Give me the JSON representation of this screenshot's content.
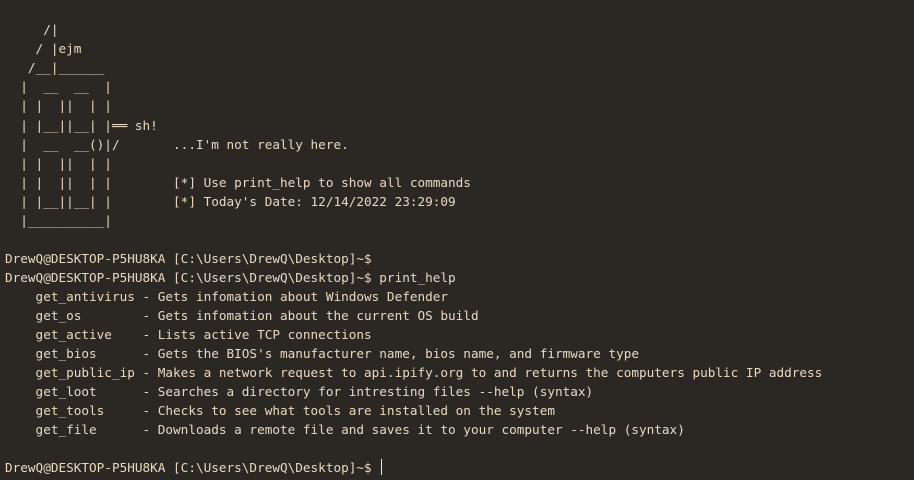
{
  "banner_lines": [
    "     /|",
    "    / |ejm",
    "   /__|______",
    "  |  __  __  |",
    "  | |  ||  | |",
    "  | |__||__| |══ sh!",
    "  |  __  __()|/       ...I'm not really here.",
    "  | |  ||  | |",
    "  | |  ||  | |        [*] Use print_help to show all commands",
    "  | |__||__| |        [*] Today's Date: 12/14/2022 23:29:09",
    "  |__________|"
  ],
  "session_lines": [
    "DrewQ@DESKTOP-P5HU8KA [C:\\Users\\DrewQ\\Desktop]~$",
    "DrewQ@DESKTOP-P5HU8KA [C:\\Users\\DrewQ\\Desktop]~$ print_help",
    "    get_antivirus - Gets infomation about Windows Defender",
    "    get_os        - Gets infomation about the current OS build",
    "    get_active    - Lists active TCP connections",
    "    get_bios      - Gets the BIOS's manufacturer name, bios name, and firmware type",
    "    get_public_ip - Makes a network request to api.ipify.org to and returns the computers public IP address",
    "    get_loot      - Searches a directory for intresting files --help (syntax)",
    "    get_tools     - Checks to see what tools are installed on the system",
    "    get_file      - Downloads a remote file and saves it to your computer --help (syntax)"
  ],
  "prompt_line": "DrewQ@DESKTOP-P5HU8KA [C:\\Users\\DrewQ\\Desktop]~$ ",
  "colors": {
    "background": "#2b2723",
    "foreground": "#e8d8c0",
    "cursor": "#f0e4d2"
  }
}
